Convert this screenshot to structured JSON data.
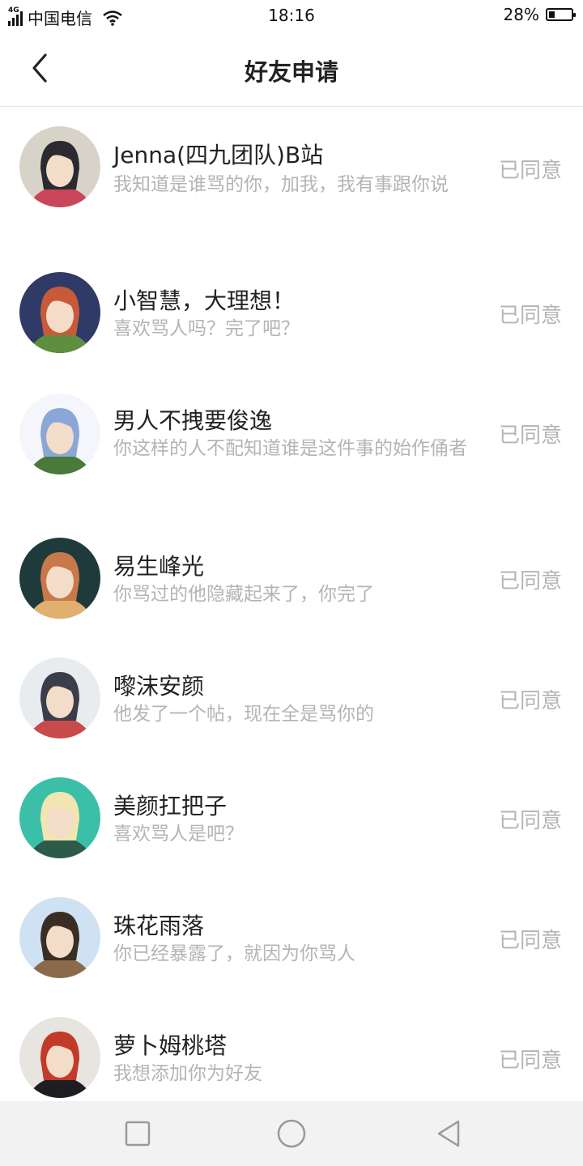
{
  "status_bar": {
    "network": "4G",
    "carrier": "中国电信",
    "time": "18:16",
    "battery": "28%",
    "battery_level": 0.28
  },
  "header": {
    "title": "好友申请",
    "back_icon": "chevron-left-icon"
  },
  "requests": [
    {
      "name": "Jenna(四九团队)B站",
      "message": "我知道是谁骂的你，加我，我有事跟你说",
      "status": "已同意",
      "avatar_colors": [
        "#d8d3c8",
        "#2a2a30",
        "#c8455a"
      ]
    },
    {
      "name": "小智慧，大理想！",
      "message": "喜欢骂人吗？完了吧？",
      "status": "已同意",
      "avatar_colors": [
        "#2f3a66",
        "#c85a3a",
        "#5e8f3f"
      ]
    },
    {
      "name": "男人不拽要俊逸",
      "message": "你这样的人不配知道谁是这件事的始作俑者",
      "status": "已同意",
      "avatar_colors": [
        "#f4f6fb",
        "#8aa7d8",
        "#4a7a3a"
      ]
    },
    {
      "name": "易生峰光",
      "message": "你骂过的他隐藏起来了，你完了",
      "status": "已同意",
      "avatar_colors": [
        "#1f3a3a",
        "#c9784a",
        "#e0b070"
      ]
    },
    {
      "name": "嚟沫安颜",
      "message": "他发了一个帖，现在全是骂你的",
      "status": "已同意",
      "avatar_colors": [
        "#e9ecef",
        "#3a3d4a",
        "#c84a4a"
      ]
    },
    {
      "name": "美颜扛把子",
      "message": "喜欢骂人是吧？",
      "status": "已同意",
      "avatar_colors": [
        "#3bbfa8",
        "#f1e6b0",
        "#2d5a4a"
      ]
    },
    {
      "name": "珠花雨落",
      "message": "你已经暴露了，就因为你骂人",
      "status": "已同意",
      "avatar_colors": [
        "#cfe2f3",
        "#3a2e24",
        "#8a6a4a"
      ]
    },
    {
      "name": "萝卜姆桃塔",
      "message": "我想添加你为好友",
      "status": "已同意",
      "avatar_colors": [
        "#e8e4e0",
        "#c23a2a",
        "#1e1e22"
      ]
    }
  ],
  "system_nav": {
    "recent_icon": "square-icon",
    "home_icon": "circle-icon",
    "back_icon": "triangle-back-icon"
  }
}
